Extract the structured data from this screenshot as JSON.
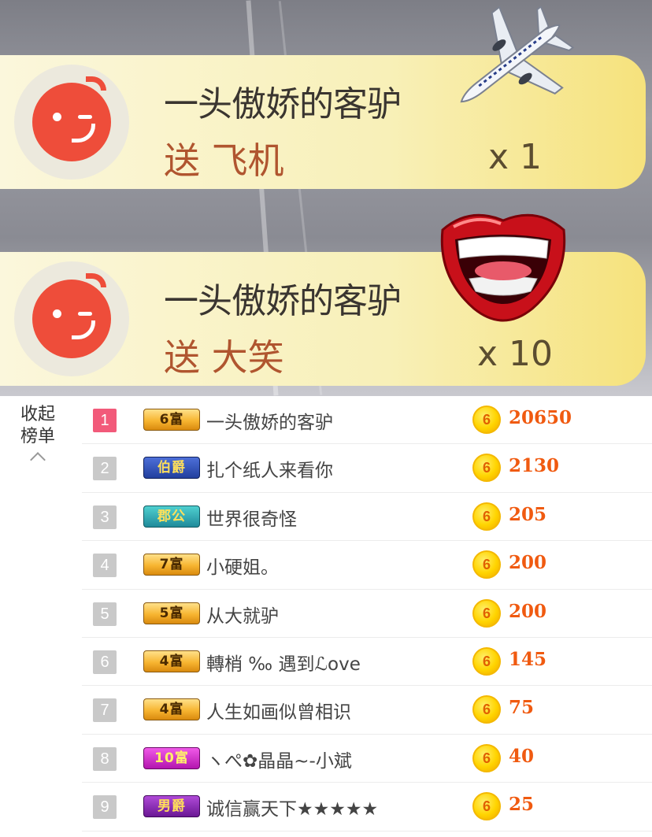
{
  "gift_banners": [
    {
      "sender": "一头傲娇的客驴",
      "action": "送 飞机",
      "count": "x 1",
      "gift_icon": "airplane-icon"
    },
    {
      "sender": "一头傲娇的客驴",
      "action": "送 大笑",
      "count": "x 10",
      "gift_icon": "laughing-lips-icon"
    }
  ],
  "ranking": {
    "collapse_label": "收起榜单",
    "rows": [
      {
        "rank": "1",
        "badge": "6富",
        "name": "一头傲娇的客驴",
        "amount": "20650"
      },
      {
        "rank": "2",
        "badge": "伯爵",
        "name": "扎个纸人来看你",
        "amount": "2130"
      },
      {
        "rank": "3",
        "badge": "郡公",
        "name": "世界很奇怪",
        "amount": "205"
      },
      {
        "rank": "4",
        "badge": "7富",
        "name": "小硬姐。",
        "amount": "200"
      },
      {
        "rank": "5",
        "badge": "5富",
        "name": "从大就驴",
        "amount": "200"
      },
      {
        "rank": "6",
        "badge": "4富",
        "name": "轉梢 ‰ 遇到ℒove",
        "amount": "145"
      },
      {
        "rank": "7",
        "badge": "4富",
        "name": "人生如画似曾相识",
        "amount": "75"
      },
      {
        "rank": "8",
        "badge": "10富",
        "name": "ヽぺ✿晶晶~-小斌",
        "amount": "40"
      },
      {
        "rank": "9",
        "badge": "男爵",
        "name": "诚信赢天下★★★★★",
        "amount": "25"
      }
    ]
  },
  "colors": {
    "rank_first": "#f25a7a",
    "rank_other": "#c9c9c9",
    "coin_amount": "#f05a10",
    "gift_action": "#b0552f"
  }
}
